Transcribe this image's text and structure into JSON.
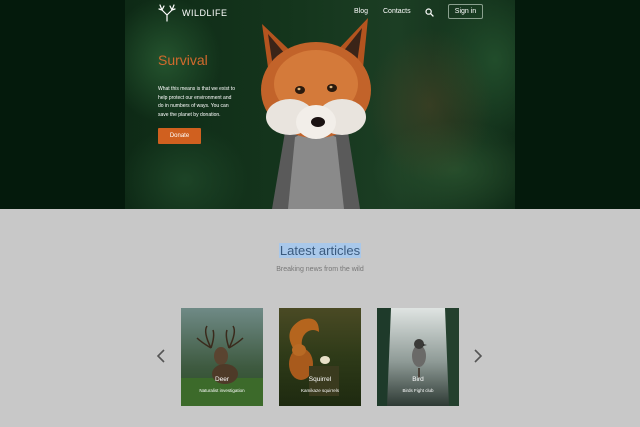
{
  "brand": {
    "name": "WILDLIFE",
    "logo_icon": "antlers-icon"
  },
  "nav": {
    "items": [
      "Blog",
      "Contacts"
    ],
    "search_icon": "search-icon",
    "signin_label": "Sign in"
  },
  "hero": {
    "title": "Survival",
    "description": "What this means is that we exist to help protect our environment and do in numbers of ways. You can save the planet by donation.",
    "donate_label": "Donate"
  },
  "articles": {
    "title": "Latest articles",
    "subtitle": "Breaking news from the wild",
    "prev_icon": "chevron-left-icon",
    "next_icon": "chevron-right-icon",
    "cards": [
      {
        "title": "Deer",
        "subtitle": "Naturalist investigation"
      },
      {
        "title": "Squirrel",
        "subtitle": "Kamikaze squirrels"
      },
      {
        "title": "Bird",
        "subtitle": "Birds Fight club"
      }
    ]
  },
  "colors": {
    "hero_bg": "#041a0c",
    "accent": "#d0601f",
    "page_bg": "#c8c8c8",
    "highlight": "#a9c8ea"
  }
}
